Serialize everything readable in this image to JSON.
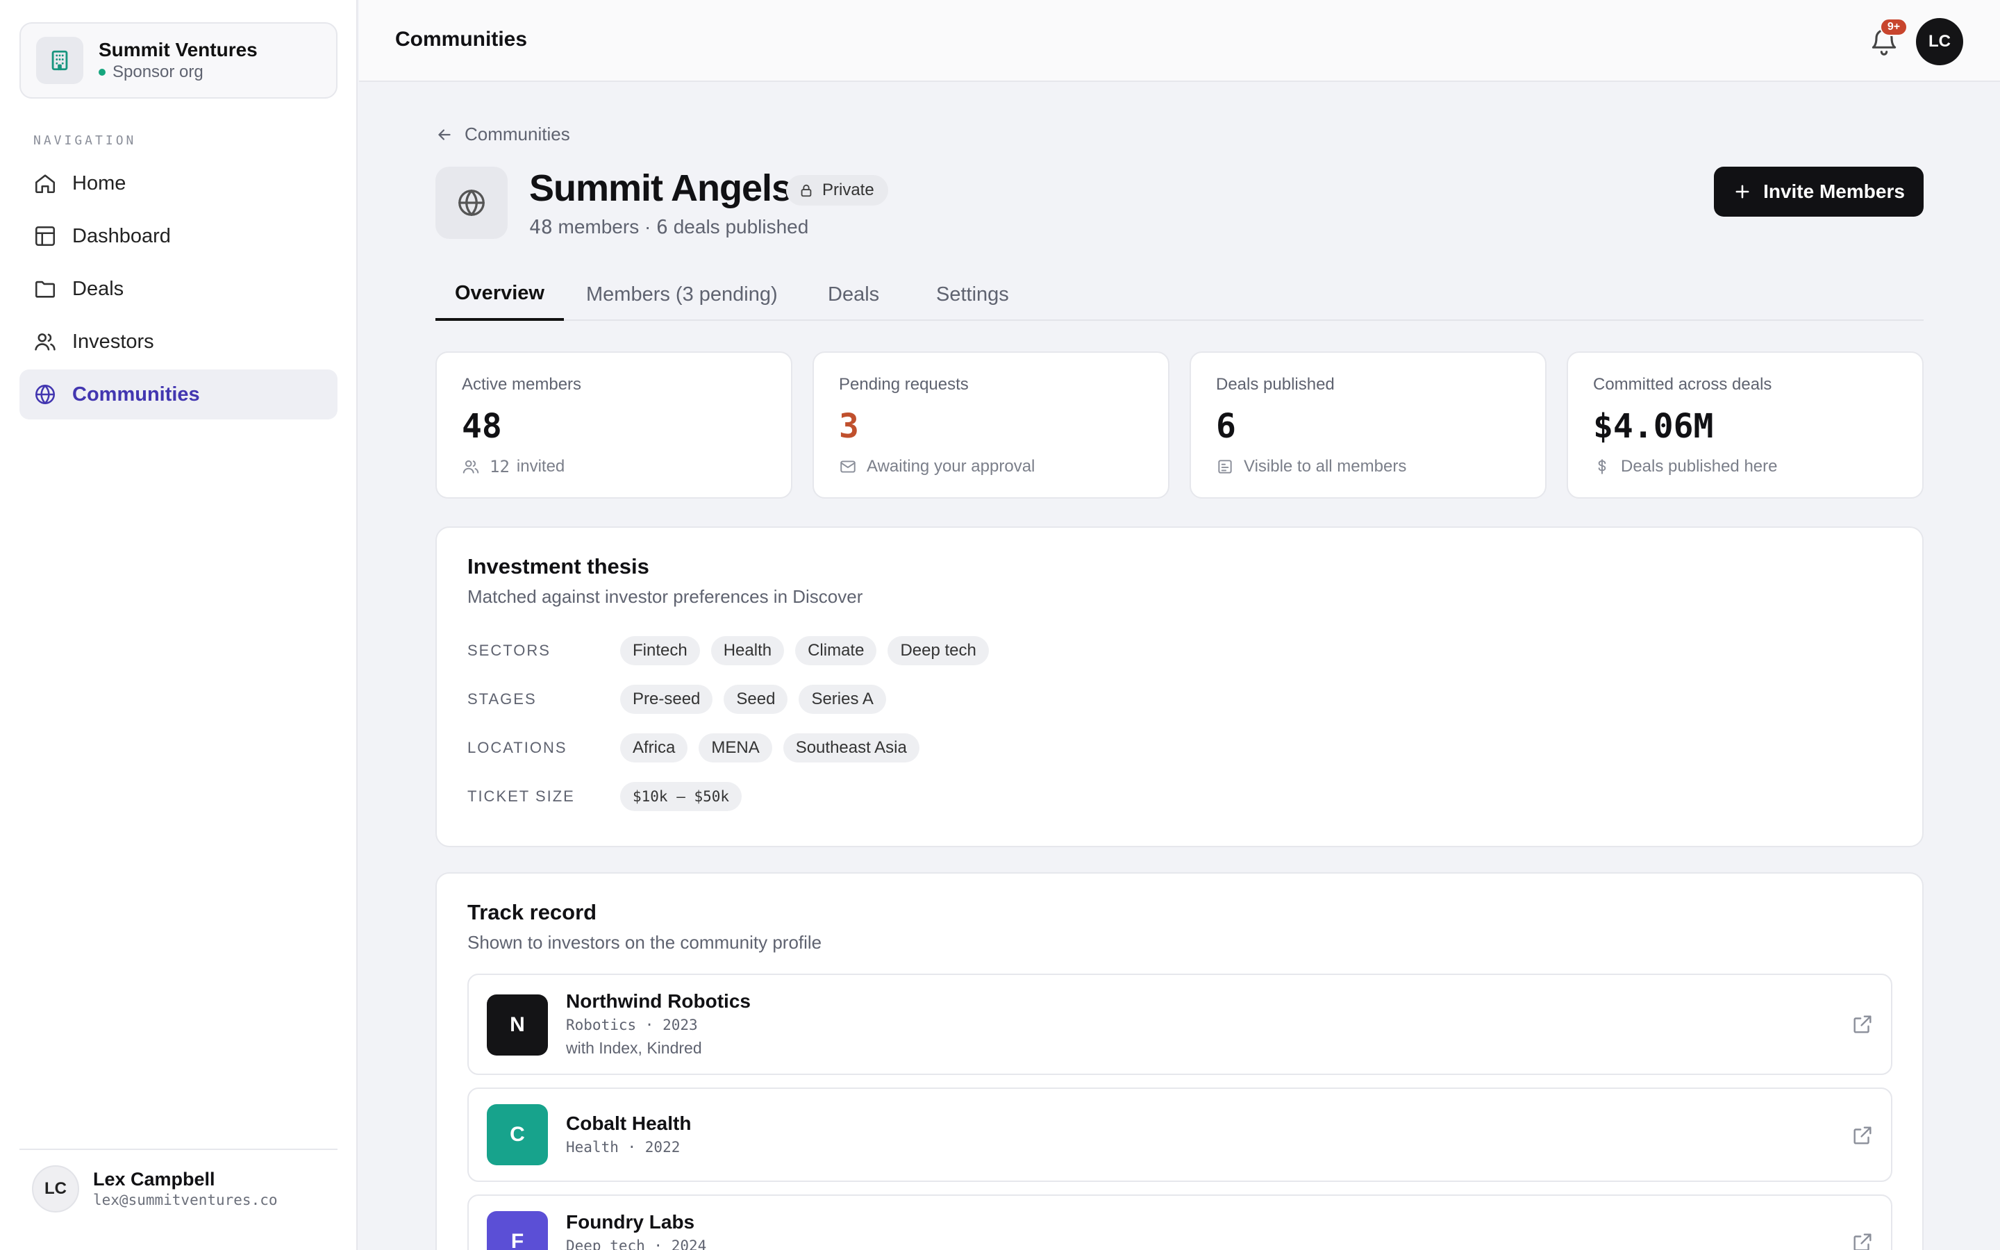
{
  "org": {
    "name": "Summit Ventures",
    "role": "Sponsor org"
  },
  "navigation": {
    "heading": "NAVIGATION",
    "items": [
      {
        "label": "Home",
        "icon": "home-icon"
      },
      {
        "label": "Dashboard",
        "icon": "layout-icon"
      },
      {
        "label": "Deals",
        "icon": "folder-icon"
      },
      {
        "label": "Investors",
        "icon": "users-icon"
      },
      {
        "label": "Communities",
        "icon": "globe-icon",
        "active": true
      }
    ]
  },
  "user": {
    "initials": "LC",
    "name": "Lex Campbell",
    "email": "lex@summitventures.co"
  },
  "topbar": {
    "title": "Communities",
    "notifications_badge": "9+",
    "avatar_initials": "LC"
  },
  "breadcrumb": {
    "back_label": "Communities"
  },
  "community": {
    "name": "Summit Angels",
    "visibility": "Private",
    "members_count": "48",
    "members_word": "members",
    "separator": "·",
    "deals_count": "6",
    "deals_word": "deals published"
  },
  "actions": {
    "invite_label": "Invite Members"
  },
  "tabs": [
    {
      "label": "Overview",
      "active": true
    },
    {
      "label": "Members (3 pending)"
    },
    {
      "label": "Deals"
    },
    {
      "label": "Settings"
    }
  ],
  "stats": {
    "active": {
      "label": "Active members",
      "value": "48",
      "foot_count": "12",
      "foot_text": "invited"
    },
    "pending": {
      "label": "Pending requests",
      "value": "3",
      "foot_text": "Awaiting your approval",
      "value_color": "#c0502d"
    },
    "published": {
      "label": "Deals published",
      "value": "6",
      "foot_text": "Visible to all members"
    },
    "committed": {
      "label": "Committed across deals",
      "value": "$4.06M",
      "foot_text": "Deals published here"
    }
  },
  "thesis": {
    "title": "Investment thesis",
    "subtitle": "Matched against investor preferences in Discover",
    "sectors_label": "SECTORS",
    "sectors": [
      "Fintech",
      "Health",
      "Climate",
      "Deep tech"
    ],
    "stages_label": "STAGES",
    "stages": [
      "Pre-seed",
      "Seed",
      "Series A"
    ],
    "locations_label": "LOCATIONS",
    "locations": [
      "Africa",
      "MENA",
      "Southeast Asia"
    ],
    "ticket_label": "TICKET SIZE",
    "ticket": "$10k — $50k"
  },
  "track": {
    "title": "Track record",
    "subtitle": "Shown to investors on the community profile",
    "items": [
      {
        "initial": "N",
        "name": "Northwind Robotics",
        "meta": "Robotics · 2023",
        "with": "with Index, Kindred",
        "color": "#141416"
      },
      {
        "initial": "C",
        "name": "Cobalt Health",
        "meta": "Health · 2022",
        "color": "#17a38c"
      },
      {
        "initial": "F",
        "name": "Foundry Labs",
        "meta": "Deep tech · 2024",
        "color": "#5b4fd6"
      }
    ]
  }
}
